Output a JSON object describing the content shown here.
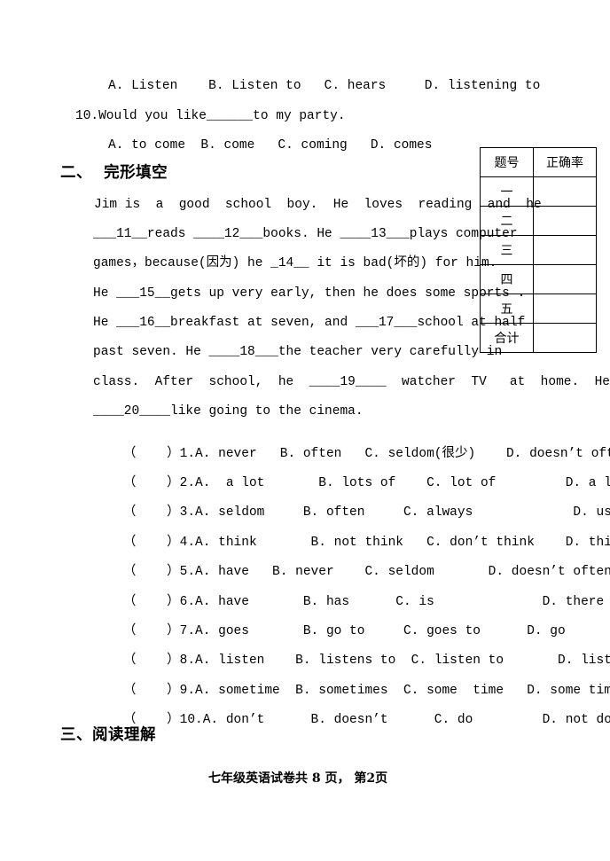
{
  "document": {
    "page_footer": "七年级英语试卷共 8 页， 第2页"
  },
  "previous_section_tail": {
    "q9_options": "A. Listen    B. Listen to   C. hears     D. listening to",
    "q10_stem": "10.Would you like______to my party.",
    "q10_options": "A. to come  B. come   C. coming   D. comes"
  },
  "section_two": {
    "heading": "二、  完形填空",
    "passage_lines": [
      "Jim is  a  good  school  boy.  He  loves  reading  and  he",
      "___11__reads ____12___books. He ____13___plays computer",
      "games，because(因为) he _14__ it is bad(坏的) for him.",
      "He ___15__gets up very early, then he does some sports .",
      "He ___16__breakfast at seven, and ___17___school at half",
      "past seven. He ____18___the teacher very carefully in",
      "class.  After  school,  he  ____19____  watcher  TV   at  home.  He",
      "____20____like going to the cinema."
    ],
    "questions": [
      {
        "bracket": "（    ）",
        "number": "1.",
        "options": "A. never   B. often   C. seldom(很少)    D. doesn’t often"
      },
      {
        "bracket": "（    ）",
        "number": "2.",
        "options": "A.  a lot       B. lots of    C. lot of         D. a lots of"
      },
      {
        "bracket": "（    ）",
        "number": "3.",
        "options": "A. seldom     B. often     C. always             D. usually"
      },
      {
        "bracket": "（    ）",
        "number": "4.",
        "options": "A. think       B. not think   C. don’t think    D. thinks"
      },
      {
        "bracket": "（    ）",
        "number": "5.",
        "options": "A. have   B. never    C. seldom       D. doesn’t often"
      },
      {
        "bracket": "（    ）",
        "number": "6.",
        "options": "A. have       B. has      C. is              D. there is"
      },
      {
        "bracket": "（    ）",
        "number": "7.",
        "options": "A. goes       B. go to     C. goes to      D. go"
      },
      {
        "bracket": "（    ）",
        "number": "8.",
        "options": "A. listen    B. listens to  C. listen to       D. listen"
      },
      {
        "bracket": "（    ）",
        "number": "9.",
        "options": "A. sometime  B. sometimes  C. some  time   D. some times"
      },
      {
        "bracket": "（    ）",
        "number": "10.",
        "options": "A. don’t      B. doesn’t      C. do         D. not do"
      }
    ]
  },
  "section_three": {
    "heading": "三、阅读理解"
  },
  "score_table": {
    "headers": [
      "题号",
      "正确率"
    ],
    "rows": [
      {
        "label": "一",
        "value": ""
      },
      {
        "label": "二",
        "value": ""
      },
      {
        "label": "三",
        "value": ""
      },
      {
        "label": "四",
        "value": ""
      },
      {
        "label": "五",
        "value": ""
      },
      {
        "label": "合计",
        "value": ""
      }
    ]
  }
}
